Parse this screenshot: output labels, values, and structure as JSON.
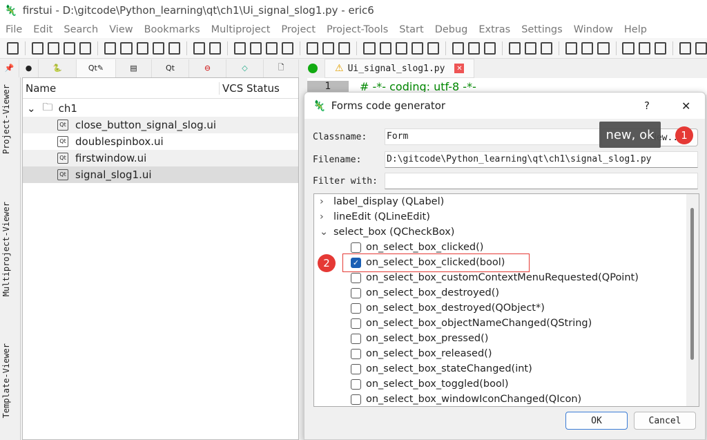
{
  "window": {
    "title": "firstui - D:\\gitcode\\Python_learning\\qt\\ch1\\Ui_signal_slog1.py - eric6"
  },
  "menu": [
    "File",
    "Edit",
    "Search",
    "View",
    "Bookmarks",
    "Multiproject",
    "Project",
    "Project-Tools",
    "Start",
    "Debug",
    "Extras",
    "Settings",
    "Window",
    "Help"
  ],
  "side_tabs": {
    "project": "Project-Viewer",
    "multiproject": "Multiproject-Viewer",
    "template": "Template-Viewer"
  },
  "tree": {
    "col_name": "Name",
    "col_vcs": "VCS Status",
    "folder": "ch1",
    "files": [
      "close_button_signal_slog.ui",
      "doublespinbox.ui",
      "firstwindow.ui",
      "signal_slog1.ui"
    ],
    "selected": "signal_slog1.ui"
  },
  "editor": {
    "tab": "Ui_signal_slog1.py",
    "line_no": "1",
    "line1": "# -*- coding: utf-8 -*-"
  },
  "dialog": {
    "title": "Forms code generator",
    "help": "?",
    "close": "✕",
    "classname_label": "Classname:",
    "classname": "Form",
    "new_btn": "New...",
    "filename_label": "Filename:",
    "filename": "D:\\gitcode\\Python_learning\\qt\\ch1\\signal_slog1.py",
    "filter_label": "Filter with:",
    "filter": "",
    "items": [
      {
        "type": "group",
        "label": "label_display (QLabel)",
        "expanded": false
      },
      {
        "type": "group",
        "label": "lineEdit (QLineEdit)",
        "expanded": false
      },
      {
        "type": "group",
        "label": "select_box (QCheckBox)",
        "expanded": true
      },
      {
        "type": "slot",
        "label": "on_select_box_clicked()",
        "checked": false
      },
      {
        "type": "slot",
        "label": "on_select_box_clicked(bool)",
        "checked": true
      },
      {
        "type": "slot",
        "label": "on_select_box_customContextMenuRequested(QPoint)",
        "checked": false
      },
      {
        "type": "slot",
        "label": "on_select_box_destroyed()",
        "checked": false
      },
      {
        "type": "slot",
        "label": "on_select_box_destroyed(QObject*)",
        "checked": false
      },
      {
        "type": "slot",
        "label": "on_select_box_objectNameChanged(QString)",
        "checked": false
      },
      {
        "type": "slot",
        "label": "on_select_box_pressed()",
        "checked": false
      },
      {
        "type": "slot",
        "label": "on_select_box_released()",
        "checked": false
      },
      {
        "type": "slot",
        "label": "on_select_box_stateChanged(int)",
        "checked": false
      },
      {
        "type": "slot",
        "label": "on_select_box_toggled(bool)",
        "checked": false
      },
      {
        "type": "slot",
        "label": "on_select_box_windowIconChanged(QIcon)",
        "checked": false
      }
    ],
    "ok": "OK",
    "cancel": "Cancel"
  },
  "annotations": {
    "tooltip": "new, ok",
    "badge1": "1",
    "badge2": "2",
    "highlight_color": "#e53935"
  }
}
